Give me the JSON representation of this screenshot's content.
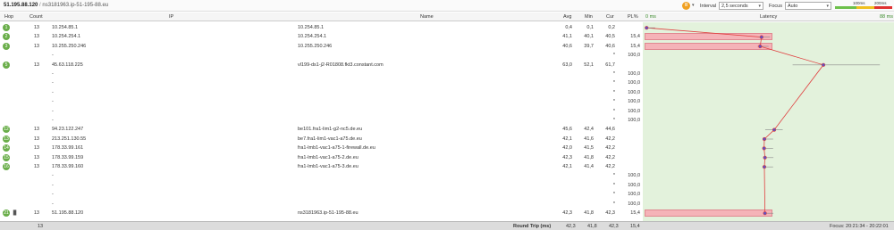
{
  "title": {
    "ip": "51.195.88.120",
    "sep": "/",
    "host": "ns3181963.ip-51-195-88.eu"
  },
  "controls": {
    "interval_label": "Interval",
    "interval_value": "2,5 seconds",
    "focus_label": "Focus",
    "focus_value": "Auto",
    "legend_100": "100ms",
    "legend_200": "200ms",
    "button_icon": "pause-icon"
  },
  "columns": {
    "hop": "Hop",
    "count": "Count",
    "ip": "IP",
    "name": "Name",
    "avg": "Avg",
    "min": "Min",
    "cur": "Cur",
    "pl": "PL%",
    "scale_min": "0 ms",
    "latency": "Latency",
    "scale_max": "88 ms"
  },
  "rows": [
    {
      "hop": "1",
      "count": "13",
      "ip": "10.254.85.1",
      "name": "10.254.85.1",
      "avg": "0,4",
      "min": "0,1",
      "cur": "0,2",
      "pl": "",
      "pl_pct": 0,
      "badge": true
    },
    {
      "hop": "2",
      "count": "13",
      "ip": "10.254.254.1",
      "name": "10.254.254.1",
      "avg": "41,1",
      "min": "40,1",
      "cur": "40,5",
      "pl": "15,4",
      "pl_pct": 15.4,
      "badge": true
    },
    {
      "hop": "3",
      "count": "13",
      "ip": "10.255.250.246",
      "name": "10.255.250.246",
      "avg": "40,6",
      "min": "39,7",
      "cur": "40,6",
      "pl": "15,4",
      "pl_pct": 15.4,
      "badge": true
    },
    {
      "hop": "",
      "count": "",
      "ip": "-",
      "name": "",
      "avg": "",
      "min": "",
      "cur": "*",
      "pl": "100,0",
      "pl_pct": 100,
      "badge": false
    },
    {
      "hop": "5",
      "count": "13",
      "ip": "45.63.118.225",
      "name": "vl199-ds1-j2-R01808.fkt3.constant.com",
      "avg": "63,0",
      "min": "52,1",
      "cur": "61,7",
      "pl": "",
      "pl_pct": 0,
      "badge": true
    },
    {
      "hop": "",
      "count": "",
      "ip": "-",
      "name": "",
      "avg": "",
      "min": "",
      "cur": "*",
      "pl": "100,0",
      "pl_pct": 100,
      "badge": false
    },
    {
      "hop": "",
      "count": "",
      "ip": "-",
      "name": "",
      "avg": "",
      "min": "",
      "cur": "*",
      "pl": "100,0",
      "pl_pct": 100,
      "badge": false
    },
    {
      "hop": "",
      "count": "",
      "ip": "-",
      "name": "",
      "avg": "",
      "min": "",
      "cur": "*",
      "pl": "100,0",
      "pl_pct": 100,
      "badge": false
    },
    {
      "hop": "",
      "count": "",
      "ip": "-",
      "name": "",
      "avg": "",
      "min": "",
      "cur": "*",
      "pl": "100,0",
      "pl_pct": 100,
      "badge": false
    },
    {
      "hop": "",
      "count": "",
      "ip": "-",
      "name": "",
      "avg": "",
      "min": "",
      "cur": "*",
      "pl": "100,0",
      "pl_pct": 100,
      "badge": false
    },
    {
      "hop": "",
      "count": "",
      "ip": "-",
      "name": "",
      "avg": "",
      "min": "",
      "cur": "*",
      "pl": "100,0",
      "pl_pct": 100,
      "badge": false
    },
    {
      "hop": "12",
      "count": "13",
      "ip": "94.23.122.247",
      "name": "be101.fra1-lim1-g2-nc5.de.eu",
      "avg": "45,6",
      "min": "42,4",
      "cur": "44,6",
      "pl": "",
      "pl_pct": 0,
      "badge": true
    },
    {
      "hop": "13",
      "count": "13",
      "ip": "213.251.130.55",
      "name": "be7.fra1-lim1-vac1-a75.de.eu",
      "avg": "42,1",
      "min": "41,6",
      "cur": "42,2",
      "pl": "",
      "pl_pct": 0,
      "badge": true
    },
    {
      "hop": "14",
      "count": "13",
      "ip": "178.33.99.161",
      "name": "fra1-lmb1-vac1-a75-1-firewall.de.eu",
      "avg": "42,0",
      "min": "41,5",
      "cur": "42,2",
      "pl": "",
      "pl_pct": 0,
      "badge": true
    },
    {
      "hop": "15",
      "count": "13",
      "ip": "178.33.99.159",
      "name": "fra1-lmb1-vac1-a75-2.de.eu",
      "avg": "42,3",
      "min": "41,8",
      "cur": "42,2",
      "pl": "",
      "pl_pct": 0,
      "badge": true
    },
    {
      "hop": "16",
      "count": "13",
      "ip": "178.33.99.160",
      "name": "fra1-lmb1-vac1-a75-3.de.eu",
      "avg": "42,1",
      "min": "41,4",
      "cur": "42,2",
      "pl": "",
      "pl_pct": 0,
      "badge": true
    },
    {
      "hop": "",
      "count": "",
      "ip": "-",
      "name": "",
      "avg": "",
      "min": "",
      "cur": "*",
      "pl": "100,0",
      "pl_pct": 100,
      "badge": false
    },
    {
      "hop": "",
      "count": "",
      "ip": "-",
      "name": "",
      "avg": "",
      "min": "",
      "cur": "*",
      "pl": "100,0",
      "pl_pct": 100,
      "badge": false
    },
    {
      "hop": "",
      "count": "",
      "ip": "-",
      "name": "",
      "avg": "",
      "min": "",
      "cur": "*",
      "pl": "100,0",
      "pl_pct": 100,
      "badge": false
    },
    {
      "hop": "",
      "count": "",
      "ip": "-",
      "name": "",
      "avg": "",
      "min": "",
      "cur": "*",
      "pl": "100,0",
      "pl_pct": 100,
      "badge": false
    },
    {
      "hop": "21",
      "count": "13",
      "ip": "51.195.88.120",
      "name": "ns3181963.ip-51-195-88.eu",
      "avg": "42,3",
      "min": "41,8",
      "cur": "42,3",
      "pl": "15,4",
      "pl_pct": 15.4,
      "badge": true,
      "bars_icon": true
    }
  ],
  "footer": {
    "count": "13",
    "label": "Round Trip (ms)",
    "avg": "42,3",
    "min": "41,8",
    "cur": "42,3",
    "pl": "15,4",
    "focus": "Focus: 20:21:34 - 20:22:01"
  },
  "colors": {
    "accent": "#f0a020",
    "graph_bg": "#e3f2dc",
    "line": "#e04040",
    "loss": "#f5b3b8",
    "badge": "#6aae4a"
  }
}
